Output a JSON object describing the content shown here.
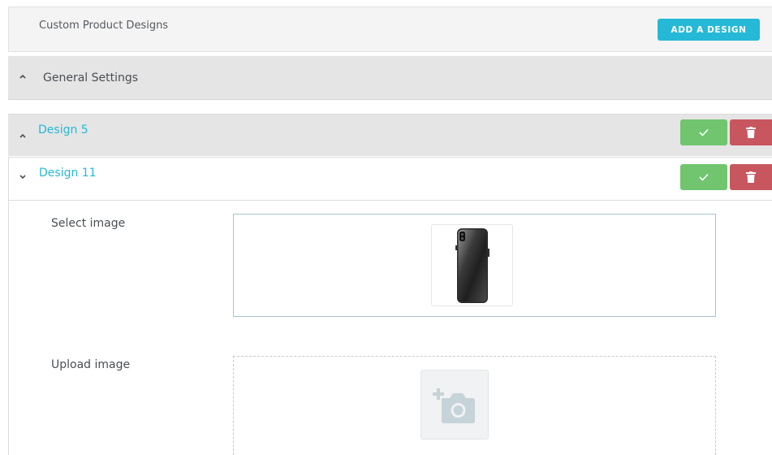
{
  "header": {
    "title": "Custom Product Designs",
    "add_button_label": "ADD A DESIGN"
  },
  "general_settings": {
    "label": "General Settings",
    "expanded": false,
    "toggle_icon": "chevron-up-icon"
  },
  "designs": [
    {
      "label": "Design 5",
      "expanded": false,
      "toggle_icon": "chevron-up-icon",
      "confirm_icon": "checkmark-icon",
      "delete_icon": "trash-icon"
    },
    {
      "label": "Design 11",
      "expanded": true,
      "toggle_icon": "chevron-down-icon",
      "confirm_icon": "checkmark-icon",
      "delete_icon": "trash-icon"
    }
  ],
  "design_form": {
    "select_image_label": "Select image",
    "selected_image_icon": "phone-product-image",
    "upload_image_label": "Upload image",
    "upload_icon": "add-camera-icon"
  },
  "colors": {
    "accent": "#25b9d7",
    "confirm": "#70c56e",
    "delete": "#c8565f",
    "bar_background": "#e5e5e5"
  }
}
